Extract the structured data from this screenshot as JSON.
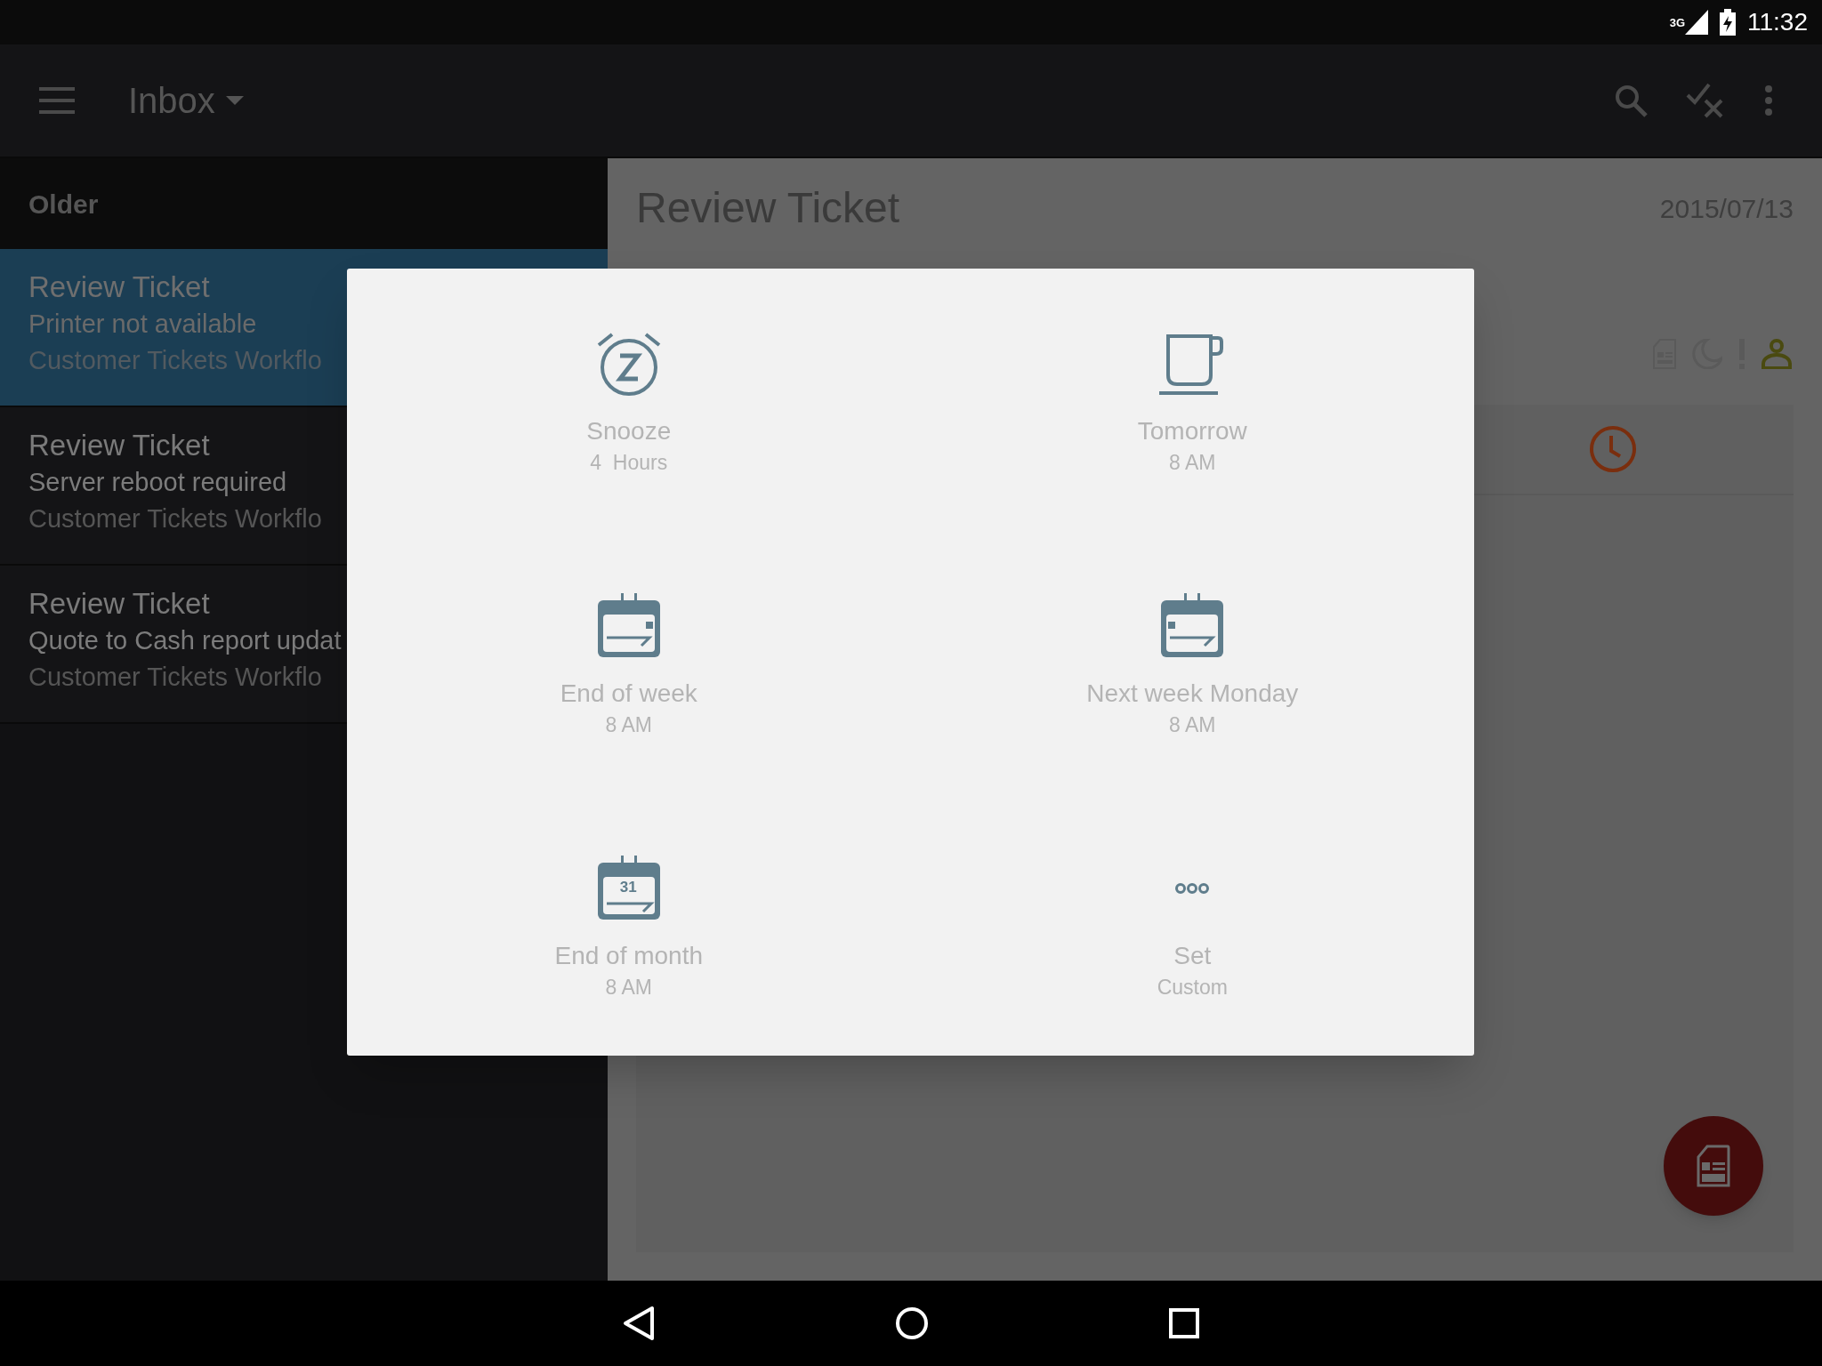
{
  "status_bar": {
    "network": "3G",
    "time": "11:32"
  },
  "app_bar": {
    "title": "Inbox"
  },
  "list": {
    "section": "Older",
    "items": [
      {
        "title": "Review Ticket",
        "subtitle": "Printer not available",
        "workflow": "Customer Tickets Workflo",
        "selected": true
      },
      {
        "title": "Review Ticket",
        "subtitle": "Server reboot required",
        "workflow": "Customer Tickets Workflo",
        "selected": false
      },
      {
        "title": "Review Ticket",
        "subtitle": "Quote to Cash report updat",
        "workflow": "Customer Tickets Workflo",
        "selected": false
      }
    ]
  },
  "detail": {
    "title": "Review Ticket",
    "date": "2015/07/13"
  },
  "snooze_dialog": {
    "options": [
      {
        "kind": "alarm",
        "label": "Snooze",
        "detail": "4  Hours"
      },
      {
        "kind": "cup",
        "label": "Tomorrow",
        "detail": "8 AM"
      },
      {
        "kind": "week_end",
        "label": "End of week",
        "detail": "8 AM"
      },
      {
        "kind": "week_next",
        "label": "Next week Monday",
        "detail": "8 AM"
      },
      {
        "kind": "month_end",
        "label": "End of month",
        "detail": "8 AM",
        "icon_text": "31"
      },
      {
        "kind": "custom",
        "label": "Set",
        "detail": "Custom"
      }
    ]
  }
}
